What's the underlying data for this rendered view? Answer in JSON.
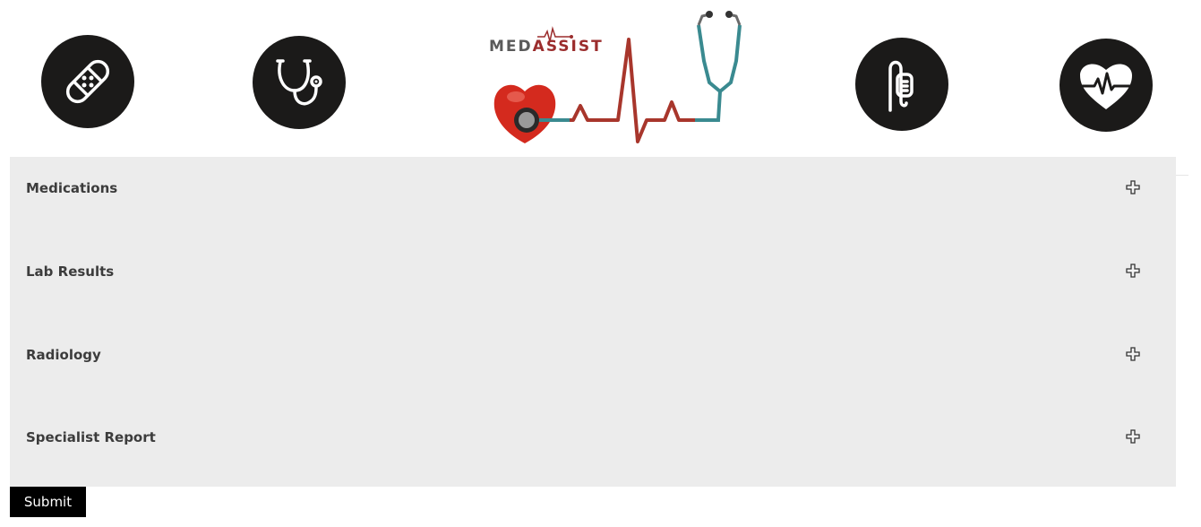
{
  "logo": {
    "text_part1": "MED",
    "text_part2": "ASSIST"
  },
  "header_icons": [
    {
      "name": "bandage-icon"
    },
    {
      "name": "stethoscope-icon"
    },
    {
      "name": "iv-bag-icon"
    },
    {
      "name": "heart-pulse-icon"
    }
  ],
  "sections": [
    {
      "title": "Medications",
      "icon": "plus-icon"
    },
    {
      "title": "Lab Results",
      "icon": "plus-icon"
    },
    {
      "title": "Radiology",
      "icon": "plus-icon"
    },
    {
      "title": "Specialist Report",
      "icon": "plus-icon"
    }
  ],
  "submit_label": "Submit",
  "colors": {
    "panel_bg": "#ececec",
    "icon_circle": "#1b1a19",
    "logo_accent": "#9b2d2d",
    "submit_bg": "#000000"
  }
}
